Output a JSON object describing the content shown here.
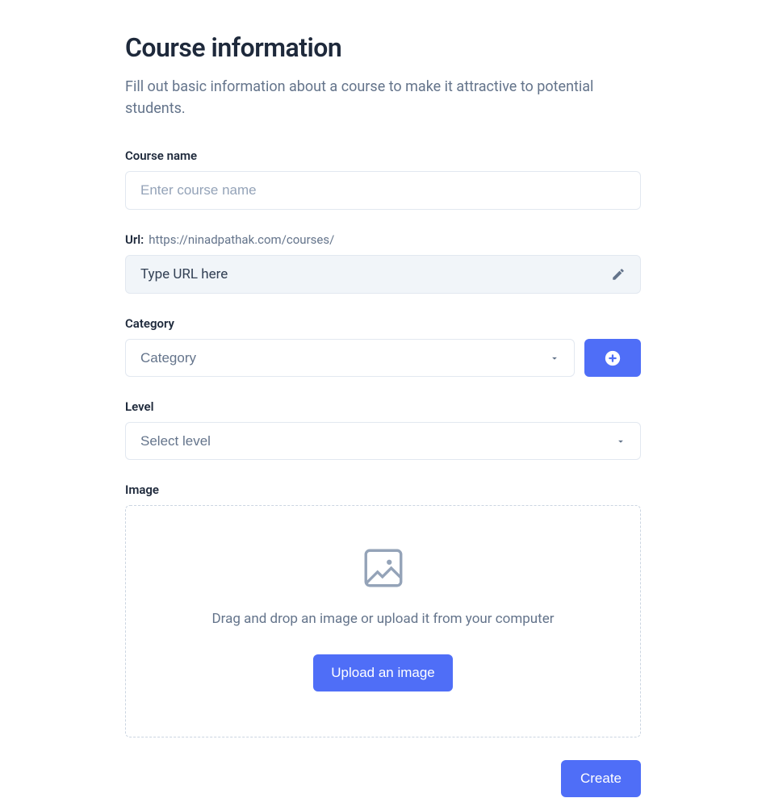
{
  "header": {
    "title": "Course information",
    "description": "Fill out basic information about a course to make it attractive to potential students."
  },
  "courseName": {
    "label": "Course name",
    "placeholder": "Enter course name",
    "value": ""
  },
  "url": {
    "label": "Url:",
    "base": "https://ninadpathak.com/courses/",
    "placeholder": "Type URL here",
    "value": ""
  },
  "category": {
    "label": "Category",
    "placeholder": "Category",
    "selected": ""
  },
  "level": {
    "label": "Level",
    "placeholder": "Select level",
    "selected": ""
  },
  "image": {
    "label": "Image",
    "dropzone_text": "Drag and drop an image or upload it from your computer",
    "upload_button": "Upload an image"
  },
  "footer": {
    "create_button": "Create"
  },
  "colors": {
    "accent": "#4f6ef7",
    "text_primary": "#1e293b",
    "text_secondary": "#64748b",
    "border": "#e2e8f0",
    "muted_bg": "#f1f5f9"
  }
}
